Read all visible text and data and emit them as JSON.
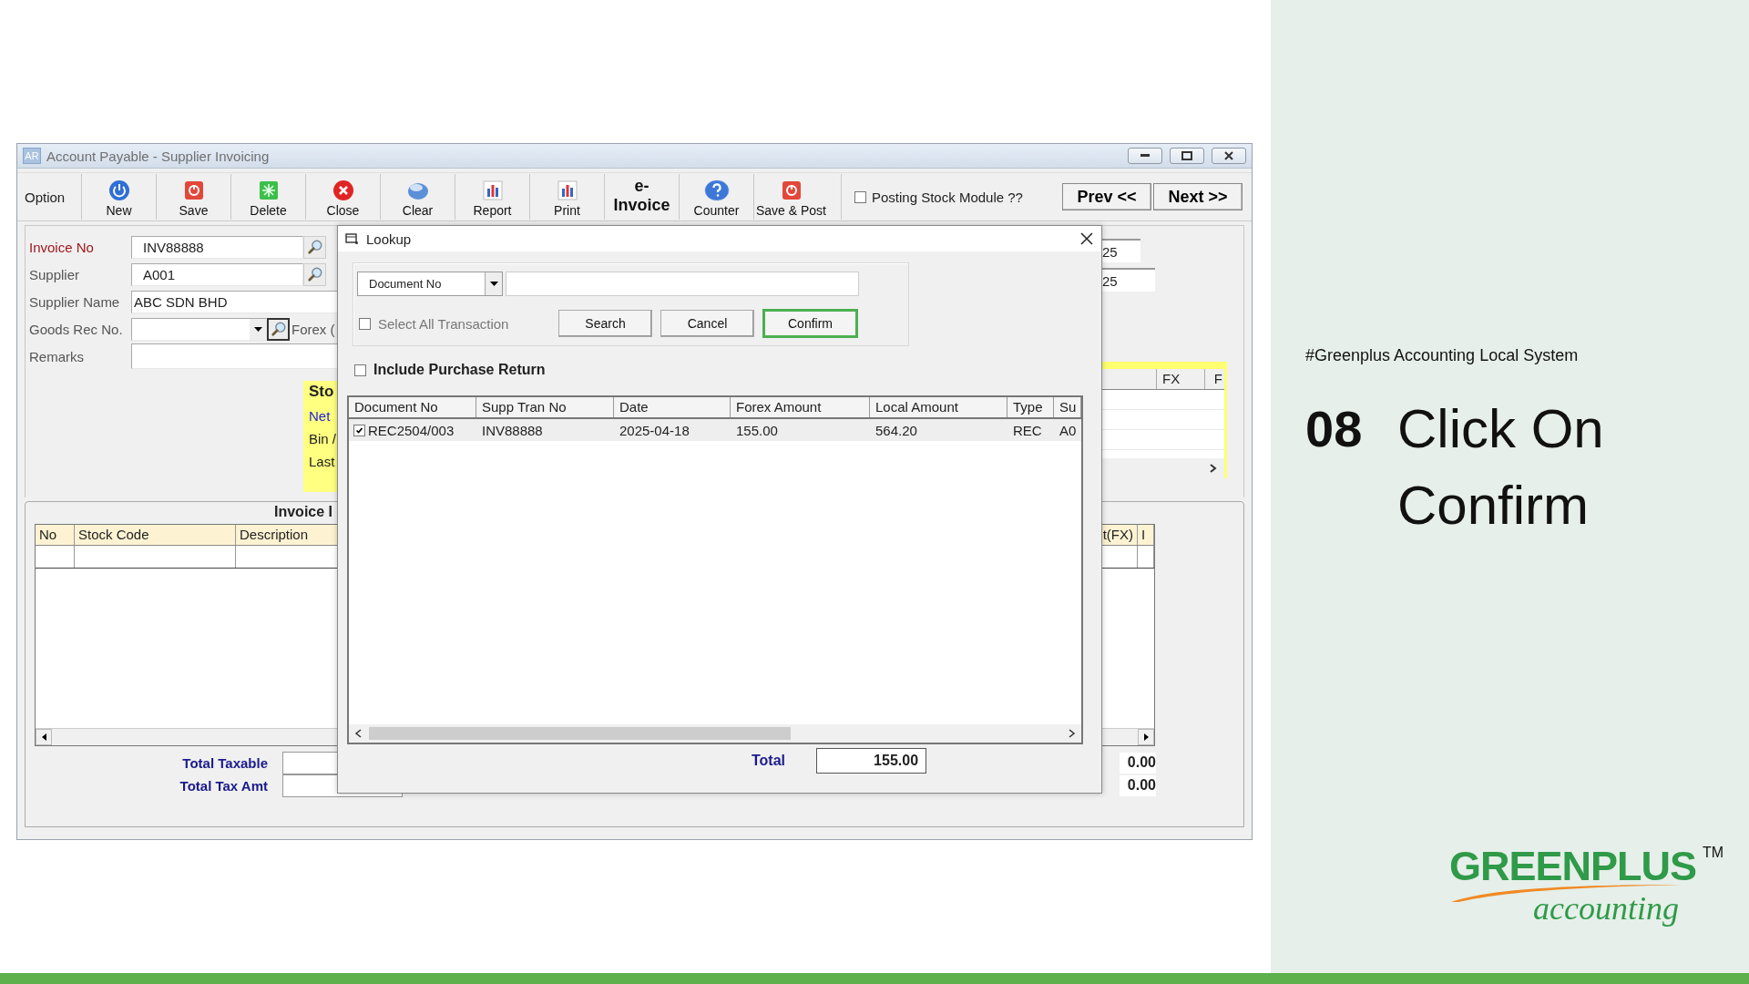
{
  "window": {
    "icon_text": "AR",
    "title": "Account Payable - Supplier Invoicing"
  },
  "toolbar": {
    "option_label": "Option",
    "buttons": [
      {
        "label": "New",
        "kind": "power"
      },
      {
        "label": "Save",
        "kind": "stop"
      },
      {
        "label": "Delete",
        "kind": "sparkle"
      },
      {
        "label": "Close",
        "kind": "cross"
      },
      {
        "label": "Clear",
        "kind": "disc"
      },
      {
        "label": "Report",
        "kind": "chart"
      },
      {
        "label": "Print",
        "kind": "chart"
      },
      {
        "label": "e-Invoice",
        "kind": "text"
      },
      {
        "label": "Counter",
        "kind": "help"
      },
      {
        "label": "Save & Post",
        "kind": "stop"
      }
    ],
    "posting_stock": {
      "label": "Posting Stock Module ??",
      "checked": false
    },
    "nav_buttons": [
      "Prev <<",
      "Next >>"
    ]
  },
  "form": {
    "fields": [
      {
        "label": "Invoice No",
        "required": true,
        "kind": "lookup",
        "value": "INV88888"
      },
      {
        "label": "Supplier",
        "required": false,
        "kind": "lookup",
        "value": "A001"
      },
      {
        "label": "Supplier Name",
        "required": false,
        "kind": "text",
        "value": "ABC SDN BHD"
      },
      {
        "label": "Goods Rec No.",
        "required": false,
        "kind": "dropdown_lookup",
        "trailing_label": "Forex ("
      },
      {
        "label": "Remarks",
        "required": false,
        "kind": "memo"
      }
    ]
  },
  "stock_panel": {
    "title": "Sto",
    "lines": [
      {
        "text": "Net",
        "kind": "link"
      },
      {
        "text": "Bin /",
        "kind": "plain"
      },
      {
        "text": "Last",
        "kind": "plain"
      }
    ]
  },
  "side_panel": {
    "fields": [
      "25",
      "25"
    ],
    "columns": [
      "FX",
      "F"
    ]
  },
  "invoice_details": {
    "title": "Invoice I",
    "columns": [
      "No",
      "Stock Code",
      "Description",
      "t(FX)",
      "I"
    ]
  },
  "totals": [
    {
      "label": "Total Taxable",
      "amount": "0.00"
    },
    {
      "label": "Total Tax Amt",
      "amount": "0.00"
    }
  ],
  "lookup": {
    "title": "Lookup",
    "search_by": "Document No",
    "select_all": {
      "label": "Select All Transaction",
      "checked": false
    },
    "buttons": [
      {
        "label": "Search",
        "highlighted": false
      },
      {
        "label": "Cancel",
        "highlighted": false
      },
      {
        "label": "Confirm",
        "highlighted": true
      }
    ],
    "include_return": {
      "label": "Include Purchase Return",
      "checked": false
    },
    "columns": [
      "Document No",
      "Supp Tran No",
      "Date",
      "Forex Amount",
      "Local Amount",
      "Type",
      "Su"
    ],
    "rows": [
      {
        "checked": true,
        "cells": [
          "REC2504/003",
          "INV88888",
          "2025-04-18",
          "155.00",
          "564.20",
          "REC",
          "A0"
        ]
      }
    ],
    "total_label": "Total",
    "total": "155.00"
  },
  "caption": {
    "tag": "#Greenplus Accounting Local System",
    "step": "08",
    "title_lines": [
      "Click On",
      "Confirm"
    ]
  },
  "logo": {
    "name": "GREENPLUS",
    "trademark": "TM",
    "tagline": "accounting"
  }
}
